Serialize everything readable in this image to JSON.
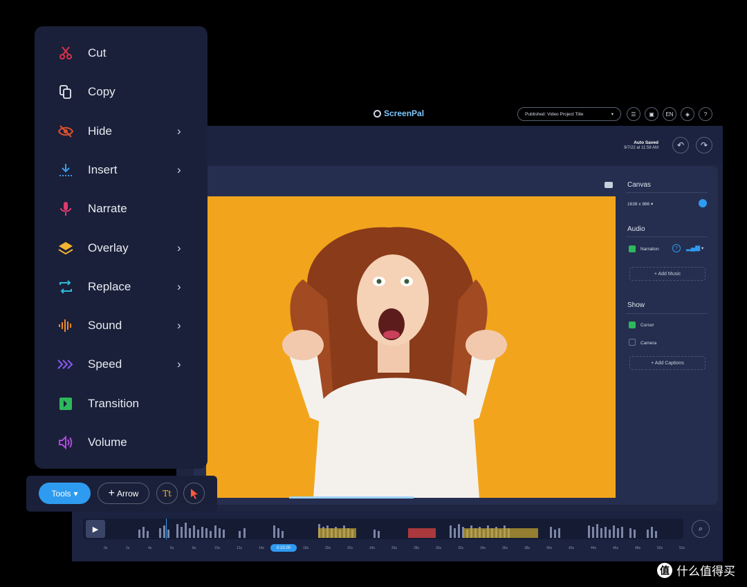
{
  "topbar": {
    "brand": "ScreenPal",
    "publish_label": "Published: Video Project Title",
    "icons": [
      "checklist-icon",
      "layout-icon",
      "language-icon",
      "layers-icon",
      "help-icon"
    ],
    "language": "EN",
    "help": "?"
  },
  "header": {
    "autosave_title": "Auto Saved",
    "autosave_time": "9/7/22 at 11:58 AM",
    "undo_icon": "undo-icon",
    "redo_icon": "redo-icon"
  },
  "panel": {
    "canvas_title": "Canvas",
    "canvas_size": "1638 x 986 ▾",
    "audio_title": "Audio",
    "narration_label": "Narration",
    "add_music_label": "+ Add Music",
    "show_title": "Show",
    "cursor_label": "Cursor",
    "camera_label": "Camera",
    "add_captions_label": "+ Add Captions"
  },
  "timeline": {
    "current_time": "0:10.00",
    "ticks": [
      "0s",
      "2s",
      "4s",
      "6s",
      "8s",
      "10s",
      "12s",
      "14s",
      "16s",
      "18s",
      "20s",
      "22s",
      "24s",
      "26s",
      "28s",
      "30s",
      "32s",
      "34s",
      "36s",
      "38s",
      "40s",
      "42s",
      "44s",
      "46s",
      "48s",
      "50s",
      "52s"
    ]
  },
  "menu": {
    "items": [
      {
        "label": "Cut",
        "icon": "scissors-icon",
        "color": "#e0304a",
        "submenu": false
      },
      {
        "label": "Copy",
        "icon": "copy-icon",
        "color": "#e8ebf2",
        "submenu": false
      },
      {
        "label": "Hide",
        "icon": "eye-slash-icon",
        "color": "#e0502a",
        "submenu": true
      },
      {
        "label": "Insert",
        "icon": "insert-icon",
        "color": "#3a9ef0",
        "submenu": true
      },
      {
        "label": "Narrate",
        "icon": "microphone-icon",
        "color": "#e03a6e",
        "submenu": false
      },
      {
        "label": "Overlay",
        "icon": "layers-icon",
        "color": "#f2b530",
        "submenu": true
      },
      {
        "label": "Replace",
        "icon": "replace-icon",
        "color": "#2fb9d8",
        "submenu": true
      },
      {
        "label": "Sound",
        "icon": "sound-wave-icon",
        "color": "#f08a2a",
        "submenu": true
      },
      {
        "label": "Speed",
        "icon": "speed-icon",
        "color": "#8a5af0",
        "submenu": true
      },
      {
        "label": "Transition",
        "icon": "transition-icon",
        "color": "#2eb85c",
        "submenu": false
      },
      {
        "label": "Volume",
        "icon": "volume-icon",
        "color": "#b04ae0",
        "submenu": false
      }
    ],
    "chevron": "›"
  },
  "toolbar": {
    "tools_label": "Tools",
    "arrow_label": "Arrow",
    "text_label": "Tt",
    "pointer_icon": "pointer-icon"
  },
  "watermark": {
    "logo": "值",
    "text": "什么值得买"
  },
  "colors": {
    "accent": "#2e9bf0",
    "video_bg": "#f2a51c",
    "panel_bg": "#1e2540"
  }
}
